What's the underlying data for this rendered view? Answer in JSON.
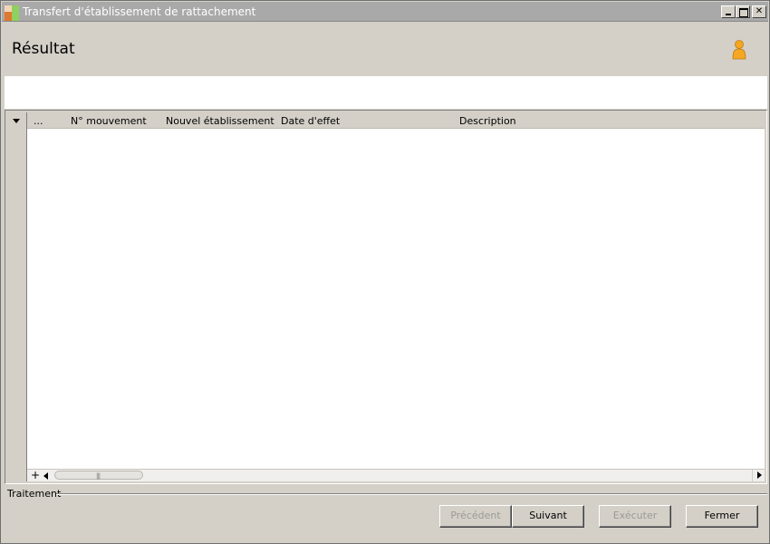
{
  "window": {
    "title": "Transfert d'établissement de rattachement",
    "icon": "app-icon",
    "controls": {
      "minimize": "minimize-icon",
      "maximize": "maximize-icon",
      "close": "✕"
    }
  },
  "header": {
    "title": "Résultat",
    "user_icon": "user-icon",
    "user_icon_color": "#f5a623"
  },
  "grid": {
    "columns": [
      "...",
      "N° mouvement",
      "Nouvel établissement",
      "Date d'effet",
      "Description"
    ],
    "rows": [],
    "footer": {
      "add_symbol": "+",
      "scroll_grip": "|||"
    }
  },
  "section": {
    "label": "Traitement"
  },
  "buttons": {
    "previous": {
      "label": "Précédent",
      "enabled": false
    },
    "next": {
      "label": "Suivant",
      "enabled": true
    },
    "execute": {
      "label": "Exécuter",
      "enabled": false
    },
    "close": {
      "label": "Fermer",
      "enabled": true
    }
  }
}
